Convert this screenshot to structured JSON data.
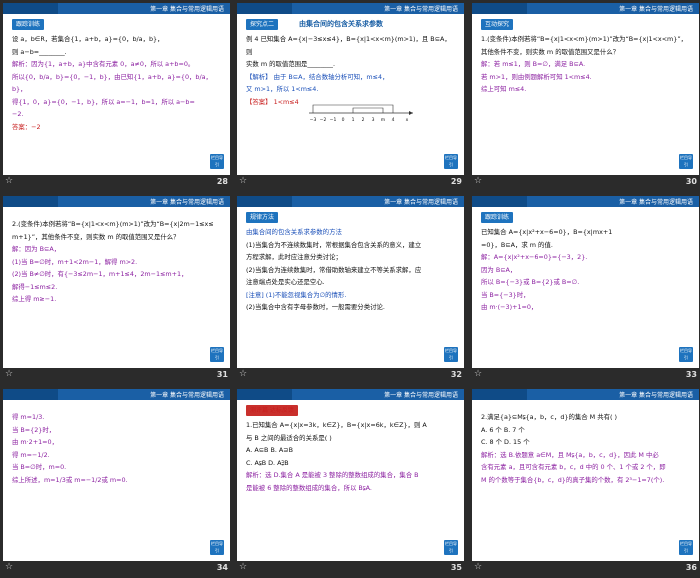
{
  "header_title": "第一章  集合与常用逻辑用语",
  "return_label": "栏目导引",
  "slides": [
    {
      "number": "28",
      "tag": "跟踪训练",
      "lines": [
        {
          "cls": "black",
          "text": "设 a，b∈R，若集合{1，a+b，a}={0，b/a，b}，"
        },
        {
          "cls": "black",
          "text": "则 a−b=________."
        },
        {
          "cls": "purple",
          "text": "解析：因为{1，a+b，a}中含有元素 0，a≠0，所以 a+b=0。"
        },
        {
          "cls": "purple",
          "text": "所以{0，b/a，b}={0，−1，b}，由已知{1，a+b，a}={0，b/a，b}，"
        },
        {
          "cls": "purple",
          "text": "得{1，0，a}={0，−1，b}，所以 a=−1，b=1，所以 a−b="
        },
        {
          "cls": "purple",
          "text": "−2."
        },
        {
          "cls": "red",
          "text": "答案：−2"
        }
      ]
    },
    {
      "number": "29",
      "tag": "探究点二",
      "heading": "由集合间的包含关系求参数",
      "lines": [
        {
          "cls": "black",
          "text": "例 4  已知集合 A={x|−3≤x≤4}，B={x|1<x<m}(m>1)，且 B⊆A，则"
        },
        {
          "cls": "black",
          "text": "实数 m 的取值范围是________."
        },
        {
          "cls": "blue",
          "text": "【解析】  由于 B⊆A，结合数轴分析可知，m≤4，"
        },
        {
          "cls": "blue",
          "text": "又 m>1，所以 1<m≤4."
        },
        {
          "cls": "black",
          "text": " "
        },
        {
          "cls": "black",
          "text": " "
        },
        {
          "cls": "red",
          "text": "【答案】  1<m≤4"
        }
      ],
      "axis_labels": [
        "−3",
        "−2",
        "−1",
        "0",
        "1",
        "2",
        "3",
        "m",
        "4",
        "x"
      ]
    },
    {
      "number": "30",
      "tag": "互动探究",
      "lines": [
        {
          "cls": "black",
          "text": "1.(变条件)本例若将“B={x|1<x<m}(m>1)”改为“B={x|1<x<m}”，"
        },
        {
          "cls": "black",
          "text": "其他条件不变，则实数 m 的取值范围又是什么？"
        },
        {
          "cls": "purple",
          "text": "解：若 m≤1，则 B=∅，满足 B⊆A."
        },
        {
          "cls": "purple",
          "text": "若 m>1，则由例题解析可知 1<m≤4."
        },
        {
          "cls": "purple",
          "text": "综上可知 m≤4."
        }
      ]
    },
    {
      "number": "31",
      "lines": [
        {
          "cls": "black",
          "text": "2.(变条件)本例若将“B={x|1<x<m}(m>1)”改为“B={x|2m−1≤x≤"
        },
        {
          "cls": "black",
          "text": "m+1}”，其他条件不变，则实数 m 的取值范围又是什么？"
        },
        {
          "cls": "purple",
          "text": "解：因为 B⊆A，"
        },
        {
          "cls": "purple",
          "text": "(1)当 B=∅时，m+1<2m−1，解得 m>2."
        },
        {
          "cls": "purple",
          "text": "(2)当 B≠∅时，有{−3≤2m−1，m+1≤4，2m−1≤m+1，"
        },
        {
          "cls": "purple",
          "text": "解得−1≤m≤2."
        },
        {
          "cls": "purple",
          "text": "综上得 m≥−1."
        }
      ]
    },
    {
      "number": "32",
      "tag": "规律方法",
      "lines": [
        {
          "cls": "blue",
          "text": "由集合间的包含关系求参数的方法"
        },
        {
          "cls": "black",
          "text": "(1)当集合为不连续数集时，常根据集合包含关系的意义，建立"
        },
        {
          "cls": "black",
          "text": "方程求解，此时应注意分类讨论；"
        },
        {
          "cls": "black",
          "text": "(2)当集合为连续数集时，常借助数轴来建立不等关系求解，应"
        },
        {
          "cls": "black",
          "text": "注意端点处是实心还是空心."
        },
        {
          "cls": "blue",
          "text": "[注意]  (1)不能忽视集合为∅的情形."
        },
        {
          "cls": "black",
          "text": "(2)当集合中含有字母参数时，一般需要分类讨论."
        }
      ]
    },
    {
      "number": "33",
      "tag": "跟踪训练",
      "lines": [
        {
          "cls": "black",
          "text": "            已知集合 A={x|x²+x−6=0}，B={x|mx+1"
        },
        {
          "cls": "black",
          "text": "=0}，B⊆A，求 m 的值."
        },
        {
          "cls": "purple",
          "text": "解：A={x|x²+x−6=0}={−3，2}."
        },
        {
          "cls": "purple",
          "text": "因为 B⊆A，"
        },
        {
          "cls": "purple",
          "text": "所以 B={−3}或 B={2}或 B=∅."
        },
        {
          "cls": "purple",
          "text": "当 B={−3}时，"
        },
        {
          "cls": "purple",
          "text": "由 m·(−3)+1=0，"
        }
      ]
    },
    {
      "number": "34",
      "lines": [
        {
          "cls": "purple",
          "text": "得 m=1/3."
        },
        {
          "cls": "purple",
          "text": "当 B={2}时，"
        },
        {
          "cls": "purple",
          "text": "由 m·2+1=0，"
        },
        {
          "cls": "purple",
          "text": "得 m=−1/2."
        },
        {
          "cls": "purple",
          "text": "当 B=∅时，m=0."
        },
        {
          "cls": "purple",
          "text": "综上所述，m=1/3或 m=−1/2或 m=0."
        }
      ]
    },
    {
      "number": "35",
      "tag": "测评篇·达标反馈",
      "lines": [
        {
          "cls": "black",
          "text": "1.已知集合 A={x|x=3k，k∈Z}，B={x|x=6k，k∈Z}，则 A"
        },
        {
          "cls": "black",
          "text": "与 B 之间的最适合的关系是(    )"
        },
        {
          "cls": "black",
          "text": "A. A⊆B              B. A⊇B"
        },
        {
          "cls": "black",
          "text": "C. A⫋B              D. A⫌B"
        },
        {
          "cls": "purple",
          "text": "解析：选 D.集合 A 是能被 3 整除的整数组成的集合，集合 B"
        },
        {
          "cls": "purple",
          "text": "是能被 6 整除的整数组成的集合，所以 B⫋A."
        }
      ]
    },
    {
      "number": "36",
      "lines": [
        {
          "cls": "black",
          "text": "2.满足{a}⊆M⫋{a，b，c，d}的集合 M 共有(    )"
        },
        {
          "cls": "black",
          "text": "A. 6 个              B. 7 个"
        },
        {
          "cls": "black",
          "text": "C. 8 个              D. 15 个"
        },
        {
          "cls": "purple",
          "text": "解析：选 B.依题意 a∈M，且 M⫋{a，b，c，d}，因此 M 中必"
        },
        {
          "cls": "purple",
          "text": "含有元素 a，且可含有元素 b，c，d 中的 0 个、1 个或 2 个，即"
        },
        {
          "cls": "purple",
          "text": "M 的个数等于集合{b，c，d}的真子集的个数，有 2³−1=7(个)."
        }
      ]
    }
  ]
}
